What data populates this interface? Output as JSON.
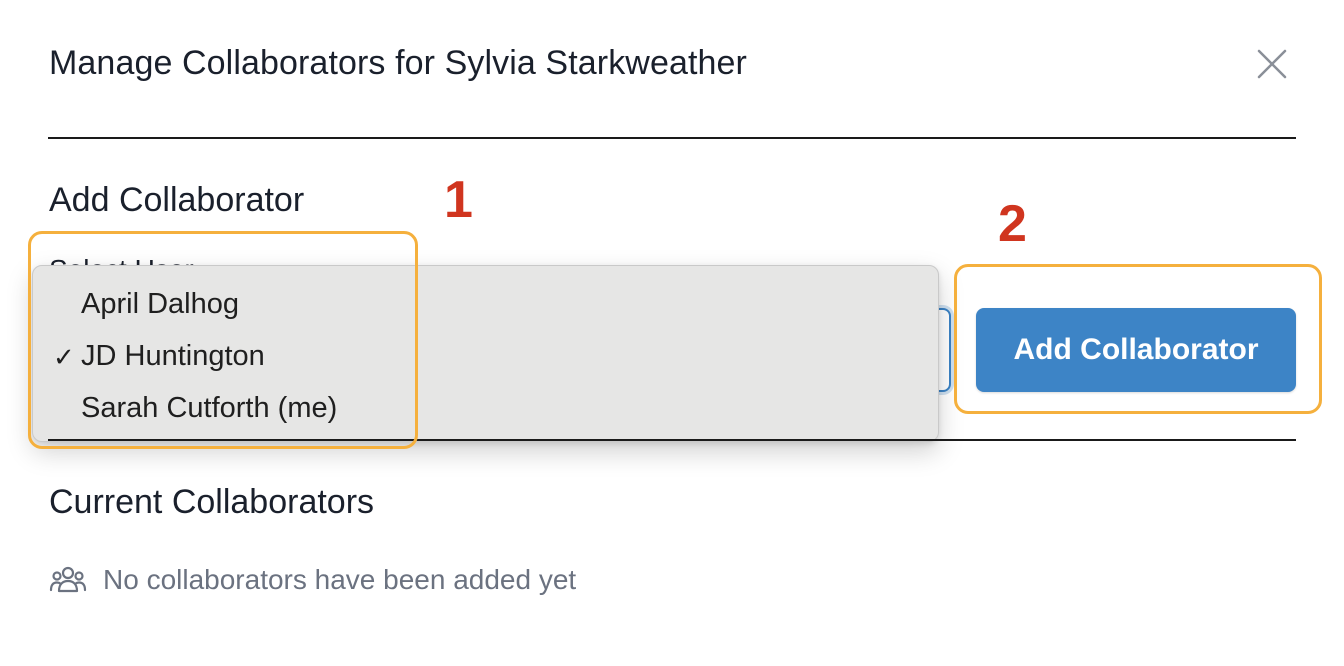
{
  "modal": {
    "title": "Manage Collaborators for Sylvia Starkweather",
    "close_icon": "close-icon"
  },
  "add_section": {
    "heading": "Add Collaborator",
    "field_label": "Select User",
    "dropdown": {
      "options": [
        {
          "label": "April Dalhog",
          "checked": false
        },
        {
          "label": "JD Huntington",
          "checked": true
        },
        {
          "label": "Sarah Cutforth (me)",
          "checked": false
        }
      ],
      "check_mark": "✓"
    },
    "add_button_label": "Add Collaborator"
  },
  "current_section": {
    "heading": "Current Collaborators",
    "empty_icon": "users-icon",
    "empty_message": "No collaborators have been added yet"
  },
  "annotations": {
    "step_1": "1",
    "step_2": "2",
    "highlight_color": "#f5b03d",
    "number_color": "#d0351f"
  },
  "colors": {
    "primary": "#3d84c6",
    "text": "#1a202c",
    "muted": "#6b7280",
    "dropdown_bg": "#e6e6e5"
  }
}
